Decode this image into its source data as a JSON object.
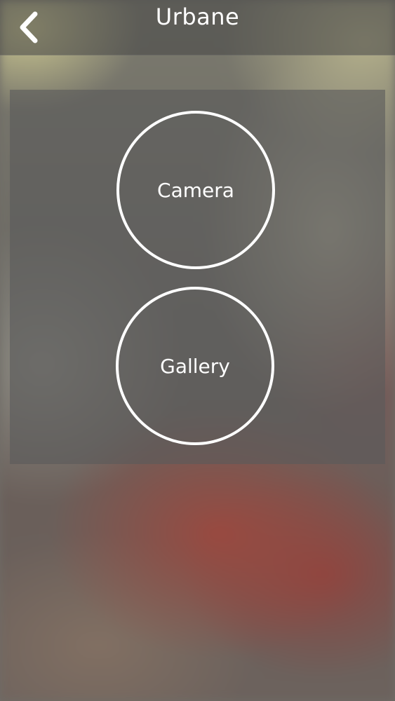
{
  "header": {
    "title": "Urbane",
    "back_icon": "chevron-left-icon"
  },
  "options": {
    "camera_label": "Camera",
    "gallery_label": "Gallery"
  },
  "colors": {
    "text": "#ffffff",
    "header_bg": "rgba(70,70,70,0.55)",
    "panel_bg": "rgba(90,90,90,0.62)"
  }
}
